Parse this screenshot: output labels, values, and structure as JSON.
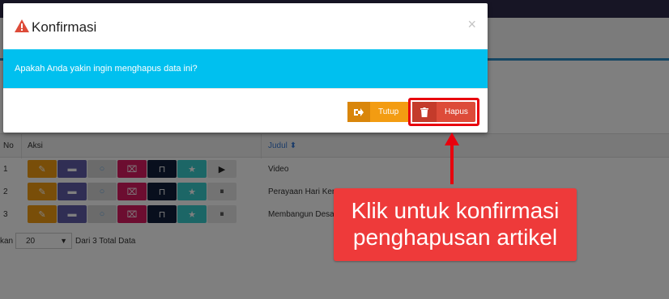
{
  "modal": {
    "title": "Konfirmasi",
    "close_glyph": "×",
    "message": "Apakah Anda yakin ingin menghapus data ini?",
    "cancel_label": "Tutup",
    "confirm_label": "Hapus"
  },
  "table": {
    "headers": {
      "no": "No",
      "aksi": "Aksi",
      "judul": "Judul"
    },
    "sort_glyph": "⬍",
    "rows": [
      {
        "no": "1",
        "title": "Video",
        "media_glyph": "▶"
      },
      {
        "no": "2",
        "title": "Perayaan Hari Ker",
        "media_glyph": "⏸"
      },
      {
        "no": "3",
        "title": "Membangun Desa",
        "media_glyph": "⏸"
      }
    ]
  },
  "pager": {
    "prefix": "kan",
    "page_size": "20",
    "summary": "Dari 3 Total Data"
  },
  "annotation": {
    "line1": "Klik untuk konfirmasi",
    "line2": "penghapusan artikel"
  },
  "colors": {
    "info": "#00c0ef",
    "warning": "#f39c12",
    "danger": "#dd4b39",
    "highlight": "#e8000d",
    "callout": "#ee3a3a"
  }
}
